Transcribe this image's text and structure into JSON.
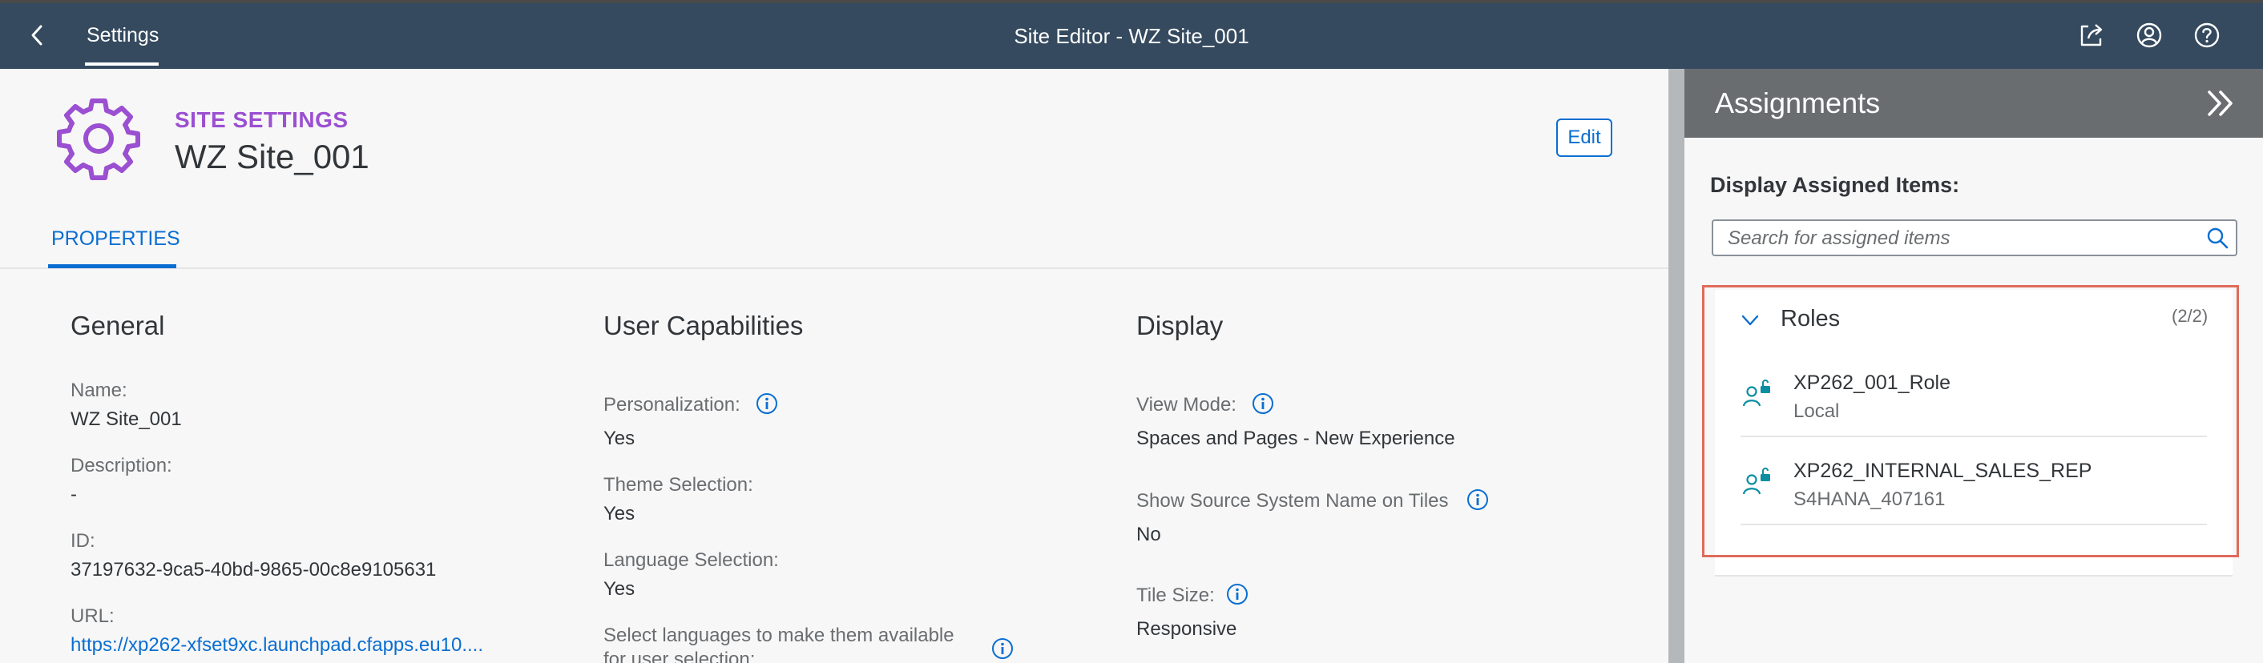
{
  "shell": {
    "tab_label": "Settings",
    "title": "Site Editor - WZ Site_001",
    "icons": [
      "back-icon",
      "share-icon",
      "user-icon",
      "help-icon"
    ]
  },
  "header": {
    "kicker": "SITE SETTINGS",
    "title": "WZ Site_001",
    "edit_label": "Edit",
    "tab_label": "PROPERTIES",
    "accent_color": "#9b4fd1",
    "link_color": "#0a6ed1"
  },
  "general": {
    "title": "General",
    "name_label": "Name:",
    "name_value": "WZ Site_001",
    "description_label": "Description:",
    "description_value": "-",
    "id_label": "ID:",
    "id_value": "37197632-9ca5-40bd-9865-00c8e9105631",
    "url_label": "URL:",
    "url_value": "https://xp262-xfset9xc.launchpad.cfapps.eu10...."
  },
  "user_capabilities": {
    "title": "User Capabilities",
    "personalization_label": "Personalization:",
    "personalization_value": "Yes",
    "theme_label": "Theme Selection:",
    "theme_value": "Yes",
    "language_label": "Language Selection:",
    "language_value": "Yes",
    "select_languages_line1": "Select languages to make them available",
    "select_languages_line2": "for user selection:"
  },
  "display": {
    "title": "Display",
    "view_mode_label": "View Mode:",
    "view_mode_value": "Spaces and Pages - New Experience",
    "source_system_label": "Show Source System Name on Tiles",
    "source_system_value": "No",
    "tile_size_label": "Tile Size:",
    "tile_size_value": "Responsive"
  },
  "assignments": {
    "title": "Assignments",
    "display_label": "Display Assigned Items:",
    "search_placeholder": "Search for assigned items",
    "roles_title": "Roles",
    "roles_count": "(2/2)",
    "roles": [
      {
        "name": "XP262_001_Role",
        "source": "Local"
      },
      {
        "name": "XP262_INTERNAL_SALES_REP",
        "source": "S4HANA_407161"
      }
    ],
    "highlight_color": "#e06a5c"
  }
}
